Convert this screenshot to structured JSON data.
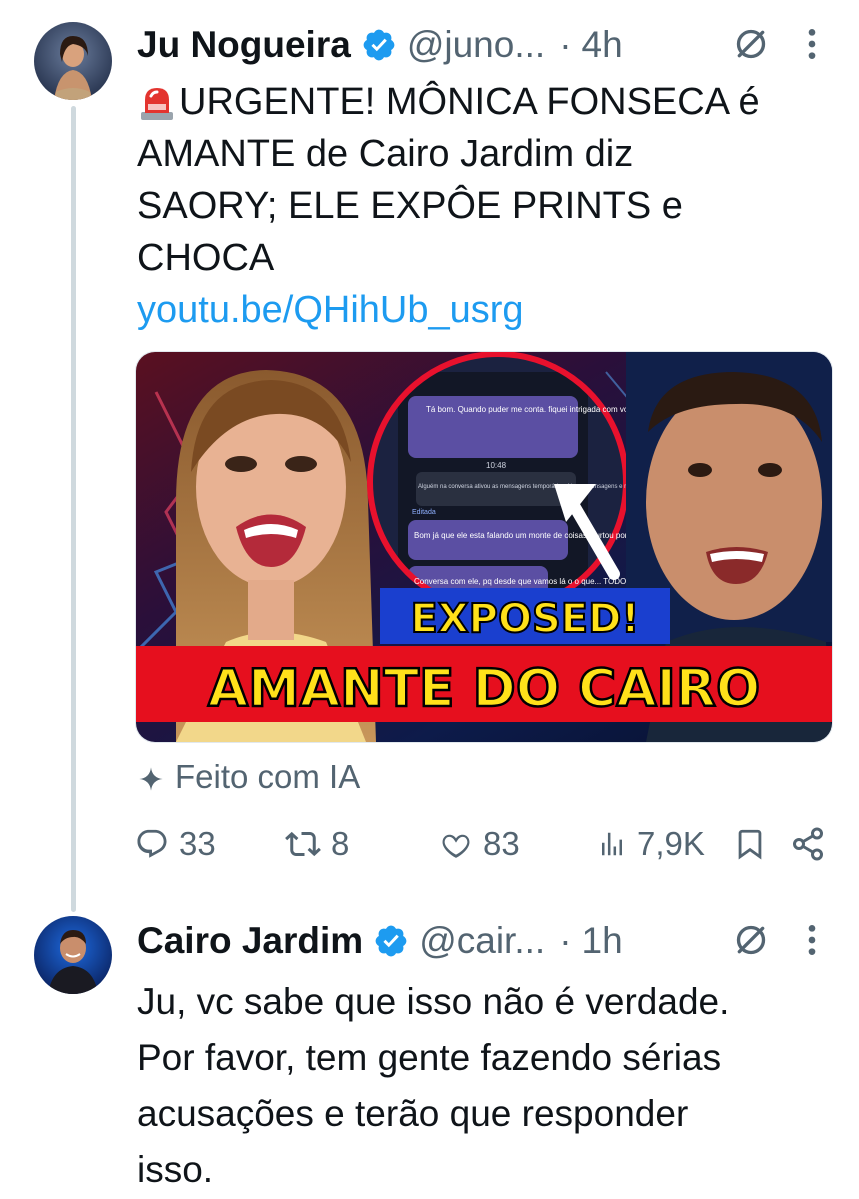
{
  "tweet1": {
    "name": "Ju Nogueira",
    "handle": "@juno...",
    "dot": "·",
    "time": "4h",
    "text_lines": [
      "URGENTE! MÔNICA FONSECA é",
      "AMANTE de Cairo Jardim diz",
      "SAORY; ELE EXPÔE PRINTS e",
      "CHOCA"
    ],
    "link": "youtu.be/QHihUb_usrg",
    "thumbnail": {
      "headline_top": "EXPOSED!",
      "headline_main": "AMANTE DO CAIRO",
      "chat_time1": "10:48",
      "chat_msg1": "Tá bom. Quando puder me conta. fiquei intrigada com você dizer que esse ciúme tem um motivo... o que exatamente acontecia nos bastidores do Link?",
      "chat_msg2": "Alguém na conversa ativou as mensagens temporárias. Novas mensagens e reações vão desaparecer 24 h depois de todos as terem visto.",
      "chat_edit": "Editada",
      "chat_msg3": "Bom já que ele esta falando um monte de coisas, surtou por causa da monica...",
      "chat_msg4": "Conversa com ele, pq desde que vamos lá o o que... TODOS bastidores falam d..."
    },
    "ai_label": "Feito com IA",
    "stats": {
      "replies": "33",
      "reposts": "8",
      "likes": "83",
      "views": "7,9K"
    }
  },
  "tweet2": {
    "name": "Cairo Jardim",
    "handle": "@cair...",
    "dot": "·",
    "time": "1h",
    "text_lines": [
      "Ju, vc sabe que isso não é verdade.",
      "Por favor, tem gente fazendo sérias",
      "acusações e terão que responder",
      "isso."
    ]
  },
  "icons": {
    "verified": "verified-badge-icon",
    "grok": "grok-icon",
    "more": "more-vertical-icon",
    "siren": "police-siren-emoji-icon",
    "sparkle": "sparkle-icon",
    "reply": "reply-icon",
    "repost": "repost-icon",
    "like": "like-icon",
    "views": "views-icon",
    "bookmark": "bookmark-icon",
    "share": "share-icon"
  },
  "colors": {
    "link": "#1d9bf0",
    "secondary_text": "#536471",
    "verified": "#1d9bf0",
    "thread_line": "#cfd9de"
  }
}
